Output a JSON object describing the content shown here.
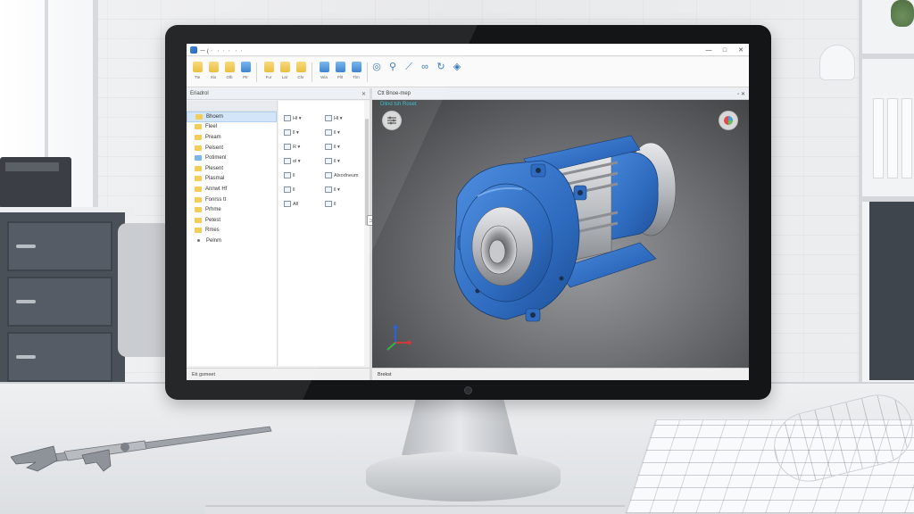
{
  "window": {
    "title": "ㅡ  (ㆍ ㆍㆍㆍ ㆍㆍ",
    "controls": {
      "minimize": "—",
      "maximize": "□",
      "close": "✕"
    }
  },
  "toolbar": {
    "groups": [
      {
        "items": [
          {
            "icon": "folder-open-icon",
            "label": "Tte"
          },
          {
            "icon": "folder-icon",
            "label": "Xio"
          },
          {
            "icon": "folder-icon",
            "label": "Olb"
          },
          {
            "icon": "save-icon",
            "label": "Ptr"
          }
        ]
      },
      {
        "items": [
          {
            "icon": "folder-icon",
            "label": "Fur"
          },
          {
            "icon": "cut-icon",
            "label": "Lar"
          },
          {
            "icon": "paste-icon",
            "label": "Chr"
          }
        ]
      },
      {
        "items": [
          {
            "icon": "shield-icon",
            "label": "Wia"
          },
          {
            "icon": "sketch-icon",
            "label": "Plrl"
          },
          {
            "icon": "diagram-icon",
            "label": "Tlm"
          }
        ]
      },
      {
        "items": [
          {
            "icon": "globe-icon",
            "label": ""
          },
          {
            "icon": "zoom-icon",
            "label": ""
          },
          {
            "icon": "measure-icon",
            "label": ""
          },
          {
            "icon": "link-icon",
            "label": ""
          },
          {
            "icon": "rotate-icon",
            "label": ""
          },
          {
            "icon": "view-icon",
            "label": ""
          }
        ]
      }
    ]
  },
  "left_panel": {
    "header": "Eriadrol",
    "close": "✕",
    "tree": [
      {
        "label": "Bhoem",
        "type": "folder",
        "selected": true
      },
      {
        "label": "Fleel",
        "type": "folder"
      },
      {
        "label": "Pream",
        "type": "folder"
      },
      {
        "label": "Pelsent",
        "type": "folder"
      },
      {
        "label": "Potimenl",
        "type": "part"
      },
      {
        "label": "Plesent",
        "type": "folder"
      },
      {
        "label": "Plasmal",
        "type": "folder"
      },
      {
        "label": "Annwt Hf",
        "type": "folder"
      },
      {
        "label": "Fonrss tt",
        "type": "folder"
      },
      {
        "label": "Prhme",
        "type": "folder"
      },
      {
        "label": "Petest",
        "type": "folder"
      },
      {
        "label": "Rmes",
        "type": "folder"
      },
      {
        "label": "Pelnm",
        "type": "dot"
      }
    ],
    "properties": [
      {
        "left": "Hl ▾",
        "right": "Hl ▾"
      },
      {
        "left": "ll ▾",
        "right": "ll ▾"
      },
      {
        "left": "R ▾",
        "right": "ll ▾"
      },
      {
        "left": "ol ▾",
        "right": "ll ▾"
      },
      {
        "left": "ll",
        "right": "Alxodneum"
      },
      {
        "left": "ll",
        "right": "ll ▾"
      },
      {
        "left": "All",
        "right": "ll"
      }
    ],
    "status": "Eti gsmeet"
  },
  "viewport": {
    "header": "Ctt Bnoe-mep",
    "header_controls": "▫ ✕",
    "title": "Dlind tsh Roset",
    "status": "Brekst",
    "colors": {
      "part": "#2f6cc0",
      "steel": "#c9ccd0",
      "background": "#6f7174"
    }
  },
  "splitter": {
    "handle": "⊃"
  }
}
